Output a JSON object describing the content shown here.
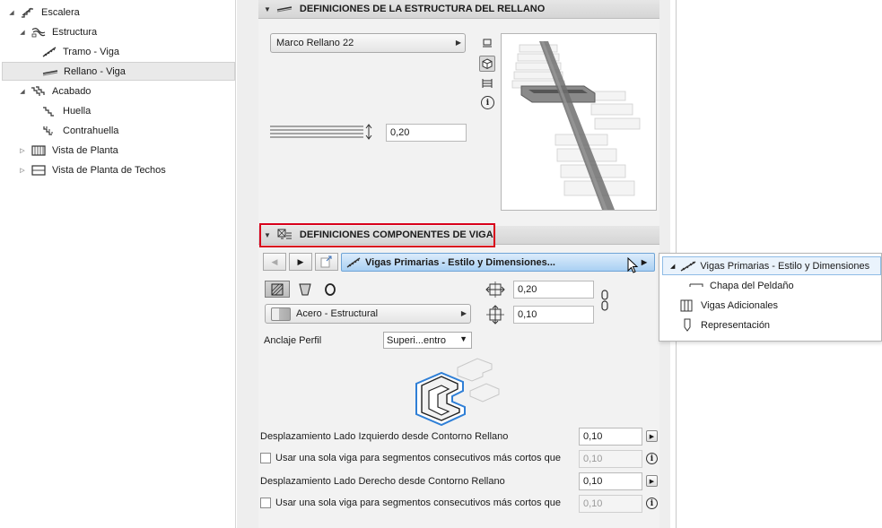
{
  "tree": {
    "items": [
      {
        "label": "Escalera",
        "icon": "stair-icon",
        "expand": "◢"
      },
      {
        "label": "Estructura",
        "icon": "structure-icon",
        "expand": "◢"
      },
      {
        "label": "Tramo - Viga",
        "icon": "flight-beam-icon",
        "expand": ""
      },
      {
        "label": "Rellano - Viga",
        "icon": "landing-beam-icon",
        "expand": ""
      },
      {
        "label": "Acabado",
        "icon": "finish-icon",
        "expand": "◢"
      },
      {
        "label": "Huella",
        "icon": "tread-icon",
        "expand": ""
      },
      {
        "label": "Contrahuella",
        "icon": "riser-icon",
        "expand": ""
      },
      {
        "label": "Vista de Planta",
        "icon": "floor-plan-icon",
        "expand": "▷"
      },
      {
        "label": "Vista de Planta de Techos",
        "icon": "ceiling-plan-icon",
        "expand": "▷"
      }
    ]
  },
  "landing": {
    "title": "DEFINICIONES DE LA ESTRUCTURA DEL RELLANO",
    "profile_label": "Marco Rellano 22",
    "thickness_value": "0,20"
  },
  "beam": {
    "title": "DEFINICIONES COMPONENTES DE VIGA",
    "nav_label": "Vigas Primarias - Estilo y Dimensiones...",
    "width_value": "0,20",
    "height_value": "0,10",
    "material_label": "Acero - Estructural",
    "anchor_label": "Anclaje Perfil",
    "anchor_value": "Superi...entro",
    "left_offset_label": "Desplazamiento Lado Izquierdo desde Contorno Rellano",
    "left_offset_value": "0,10",
    "left_single_label": "Usar una sola viga para segmentos consecutivos más cortos que",
    "left_single_value": "0,10",
    "right_offset_label": "Desplazamiento Lado Derecho desde Contorno Rellano",
    "right_offset_value": "0,10",
    "right_single_label": "Usar una sola viga para segmentos consecutivos más cortos que",
    "right_single_value": "0,10"
  },
  "popup": {
    "items": [
      {
        "label": "Vigas Primarias - Estilo y Dimensiones"
      },
      {
        "label": "Chapa del Peldaño"
      },
      {
        "label": "Vigas Adicionales"
      },
      {
        "label": "Representación"
      }
    ]
  },
  "colors": {
    "highlight_border": "#d8001b",
    "nav_blue": "#a9d0f3",
    "selection_blue": "#2f7fd6"
  }
}
